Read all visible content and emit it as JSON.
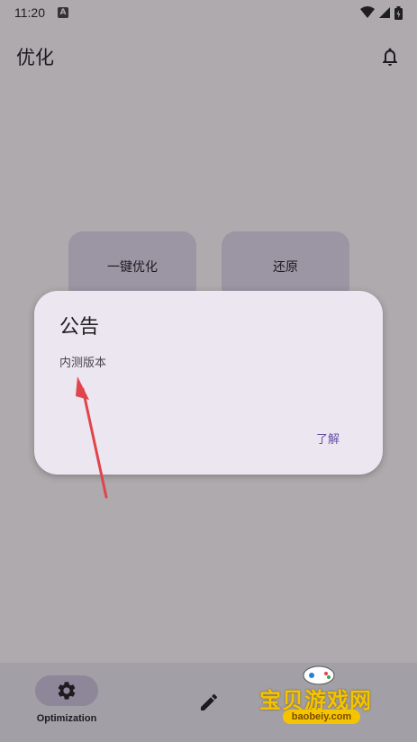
{
  "status": {
    "time": "11:20",
    "notification_letter": "A"
  },
  "app_bar": {
    "title": "优化"
  },
  "actions": {
    "optimize_label": "一键优化",
    "restore_label": "还原"
  },
  "dialog": {
    "title": "公告",
    "body": "内测版本",
    "confirm_label": "了解"
  },
  "nav": {
    "optimization_label": "Optimization"
  },
  "watermark": {
    "text": "宝贝游戏网",
    "url": "baobeiy.com"
  },
  "colors": {
    "accent": "#6750a4",
    "dialog_bg": "#ece6f0",
    "scrim_bg": "#aeaaae",
    "arrow": "#e0454b"
  }
}
